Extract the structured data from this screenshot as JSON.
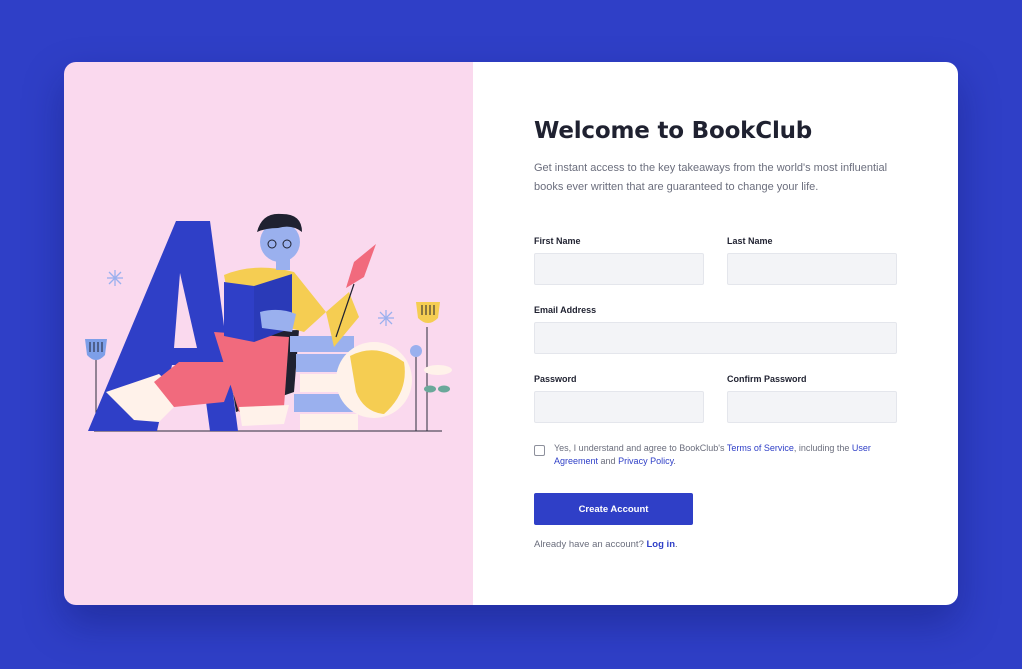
{
  "colors": {
    "background": "#2f3fc7",
    "illustration_bg": "#fad9ee",
    "accent": "#2f3fc7",
    "field_bg": "#f3f4f7"
  },
  "hero": {
    "illustration": "person-reading-book-on-letter-a-illustration"
  },
  "signup": {
    "title": "Welcome to BookClub",
    "subtitle": "Get instant access to the key takeaways from the world's most influential books ever written that are guaranteed to change your life.",
    "first_name": {
      "label": "First Name",
      "value": ""
    },
    "last_name": {
      "label": "Last Name",
      "value": ""
    },
    "email": {
      "label": "Email Address",
      "value": ""
    },
    "password": {
      "label": "Password",
      "value": ""
    },
    "confirm_password": {
      "label": "Confirm Password",
      "value": ""
    },
    "consent": {
      "checked": false,
      "text_1": "Yes, I understand and agree to BookClub's ",
      "terms_link": "Terms of Service",
      "text_2": ", including the ",
      "agreement_link": "User Agreement",
      "text_3": " and ",
      "privacy_link": "Privacy Policy",
      "text_4": "."
    },
    "submit_label": "Create Account",
    "login_prompt": "Already have an account? ",
    "login_link": "Log in",
    "login_suffix": "."
  }
}
